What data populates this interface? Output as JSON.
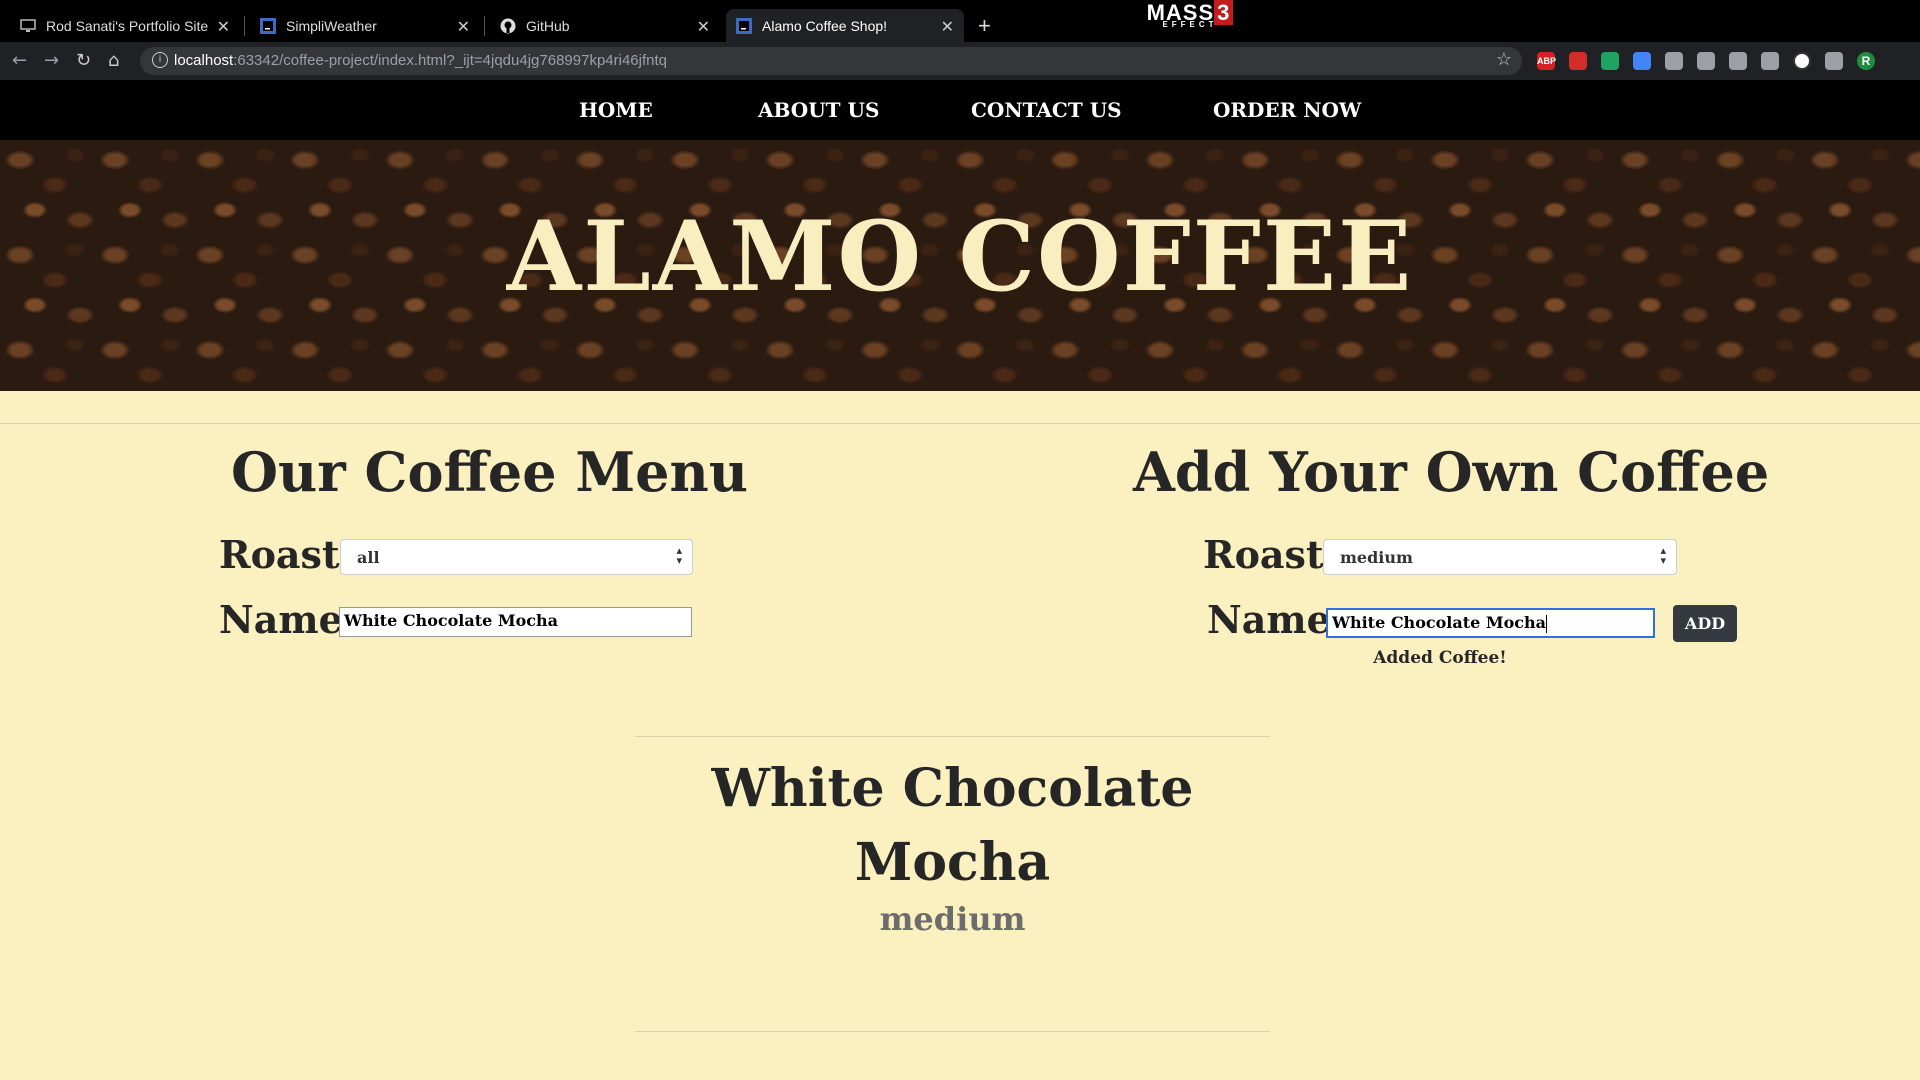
{
  "browser": {
    "tabs": [
      {
        "title": "Rod Sanati's Portfolio Site",
        "active": false
      },
      {
        "title": "SimpliWeather",
        "active": false
      },
      {
        "title": "GitHub",
        "active": false
      },
      {
        "title": "Alamo Coffee Shop!",
        "active": true
      }
    ],
    "theme_logo": {
      "text": "MASS",
      "number": "3",
      "subtext": "EFFECT"
    },
    "url": {
      "host": "localhost",
      "rest": ":63342/coffee-project/index.html?_ijt=4jqdu4jg768997kp4ri46jfntq"
    },
    "extensions": [
      {
        "name": "adblock-icon",
        "text": "ABP",
        "color": "#d81f26"
      },
      {
        "name": "lastpass-icon",
        "text": "",
        "color": "#d32d27"
      },
      {
        "name": "green-dot-icon",
        "text": "",
        "color": "#1ea362"
      },
      {
        "name": "translate-icon",
        "text": "",
        "color": "#4285f4"
      },
      {
        "name": "react-devtools-icon",
        "text": "",
        "color": "#9aa0a6"
      },
      {
        "name": "vue-icon",
        "text": "",
        "color": "#9aa0a6"
      },
      {
        "name": "dark-reader-icon",
        "text": "",
        "color": "#9aa0a6"
      },
      {
        "name": "pencil-icon",
        "text": "",
        "color": "#9aa0a6"
      },
      {
        "name": "grammarly-icon",
        "text": "",
        "color": "#ffffff"
      },
      {
        "name": "puzzle-icon",
        "text": "",
        "color": "#9aa0a6"
      },
      {
        "name": "profile-avatar",
        "text": "R",
        "color": "#1e8e3e"
      }
    ]
  },
  "nav": {
    "home": "HOME",
    "about": "ABOUT US",
    "contact": "CONTACT US",
    "order": "ORDER NOW"
  },
  "hero": {
    "title": "ALAMO COFFEE"
  },
  "menu": {
    "heading": "Our Coffee Menu",
    "roast_label": "Roast",
    "roast_value": "all",
    "name_label": "Name",
    "name_value": "White Chocolate Mocha"
  },
  "add": {
    "heading": "Add Your Own Coffee",
    "roast_label": "Roast",
    "roast_value": "medium",
    "name_label": "Name",
    "name_value": "White Chocolate Mocha",
    "button": "ADD",
    "status": "Added Coffee!"
  },
  "coffee": {
    "name": "White Chocolate Mocha",
    "roast": "medium"
  }
}
